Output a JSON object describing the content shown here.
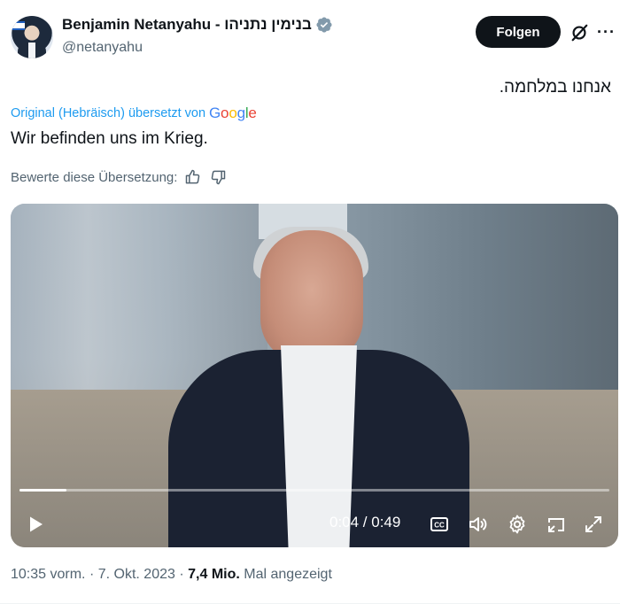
{
  "author": {
    "name": "Benjamin Netanyahu - בנימין נתניהו",
    "handle": "@netanyahu",
    "avatar_icon": "profile-photo"
  },
  "actions": {
    "follow_label": "Folgen",
    "grok_icon": "grok-icon",
    "more_label": "···"
  },
  "tweet": {
    "original_text": "אנחנו במלחמה.",
    "translated_by": "Original (Hebräisch) übersetzt von",
    "google_letters": [
      "G",
      "o",
      "o",
      "g",
      "l",
      "e"
    ],
    "translation": "Wir befinden uns im Krieg.",
    "rate_label": "Bewerte diese Übersetzung:"
  },
  "video": {
    "current_time": "0:04",
    "duration": "0:49",
    "progress_fraction": 0.08,
    "time_display": "0:04 / 0:49"
  },
  "meta": {
    "time": "10:35 vorm.",
    "date": "7. Okt. 2023",
    "views": "7,4 Mio.",
    "views_suffix": "Mal angezeigt"
  },
  "colors": {
    "accent": "#1d9bf0",
    "verified": "#829aab",
    "google": [
      "#4285F4",
      "#EA4335",
      "#FBBC05",
      "#4285F4",
      "#34A853",
      "#EA4335"
    ]
  }
}
